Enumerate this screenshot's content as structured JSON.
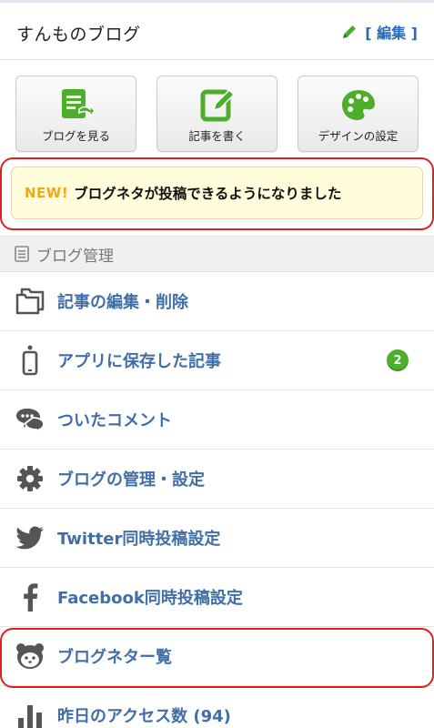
{
  "header": {
    "title": "すんものブログ",
    "edit_label": "[ 編集 ]",
    "edit_icon": "pencil-icon"
  },
  "actions": [
    {
      "label": "ブログを見る",
      "icon": "view-blog-icon"
    },
    {
      "label": "記事を書く",
      "icon": "write-post-icon"
    },
    {
      "label": "デザインの設定",
      "icon": "palette-icon"
    }
  ],
  "notice": {
    "tag": "NEW!",
    "text": "ブログネタが投稿できるようになりました"
  },
  "section": {
    "title": "ブログ管理",
    "icon": "list-icon"
  },
  "menu": [
    {
      "label": "記事の編集・削除",
      "icon": "folder-icon"
    },
    {
      "label": "アプリに保存した記事",
      "icon": "phone-icon",
      "badge": "2"
    },
    {
      "label": "ついたコメント",
      "icon": "comment-icon"
    },
    {
      "label": "ブログの管理・設定",
      "icon": "gear-icon"
    },
    {
      "label": "Twitter同時投稿設定",
      "icon": "twitter-icon"
    },
    {
      "label": "Facebook同時投稿設定",
      "icon": "facebook-icon"
    },
    {
      "label": "ブログネター覧",
      "icon": "mascot-icon"
    },
    {
      "label": "昨日のアクセス数 (94)",
      "icon": "bar-chart-icon"
    }
  ],
  "colors": {
    "accent_green": "#4cae2a",
    "link_blue": "#3f6fa6",
    "highlight_red": "#e02020",
    "notice_bg": "#fffddc",
    "new_tag": "#f0a71c"
  }
}
